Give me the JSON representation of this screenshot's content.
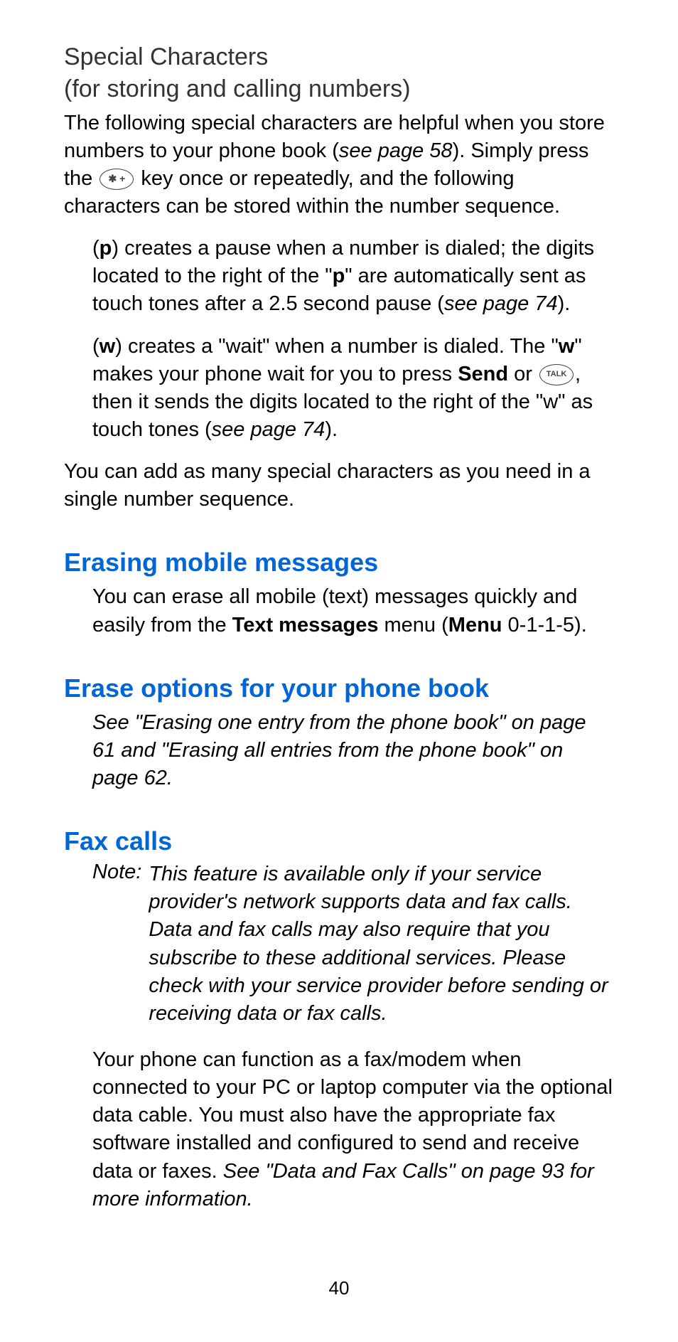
{
  "special": {
    "title_l1": "Special Characters",
    "title_l2": "(for storing and calling numbers)",
    "intro_a": "The following special characters are helpful when you store numbers to your phone book (",
    "intro_ref1": "see page 58",
    "intro_b": "). Simply press the ",
    "star_key": "✱ +",
    "intro_c": " key once or repeatedly, and the following characters can be stored within the number sequence.",
    "p_item_a": "(",
    "p_letter": "p",
    "p_item_b": ") creates a pause when a number is dialed; the digits located to the right of the \"",
    "p_letter2": "p",
    "p_item_c": "\" are automati­cally sent as touch tones after a 2.5 second pause (",
    "p_ref": "see page 74",
    "p_item_d": ").",
    "w_item_a": "(",
    "w_letter": "w",
    "w_item_b": ") creates a \"wait\" when a number is dialed. The \"",
    "w_letter2": "w",
    "w_item_c": "\" makes your phone wait for you to press ",
    "w_send": "Send",
    "w_item_d": " or ",
    "talk_key": "TALK",
    "w_item_e": ", then it sends the digits located to the right of the \"w\" as touch tones (",
    "w_ref": "see page 74",
    "w_item_f": ").",
    "outro": "You can add as many special characters as you need in a single number sequence."
  },
  "erasing": {
    "title": "Erasing mobile messages",
    "body_a": "You can erase all mobile (text) messages quickly and easily from the ",
    "body_b": "Text messages",
    "body_c": " menu (",
    "body_d": "Menu",
    "body_e": " 0-1-1-5)."
  },
  "erase_opts": {
    "title": "Erase options for your phone book",
    "ref": "See \"Erasing one entry from the phone book\" on page 61 and \"Erasing all entries from the phone book\" on page 62."
  },
  "fax": {
    "title": "Fax calls",
    "note_label": "Note:",
    "note_body": "This feature is available only if your service provider's network supports data and fax calls. Data and fax calls may also require that you subscribe to these additional services. Please check with your service provider before sending or receiving data or fax calls.",
    "body_a": "Your phone can function as a fax/modem when connected to your PC or laptop computer via the optional data cable. You must also have the appropriate fax software installed and configured to send and receive data or faxes. ",
    "body_ref": "See \"Data and Fax Calls\" on page 93 for more information."
  },
  "page_number": "40"
}
